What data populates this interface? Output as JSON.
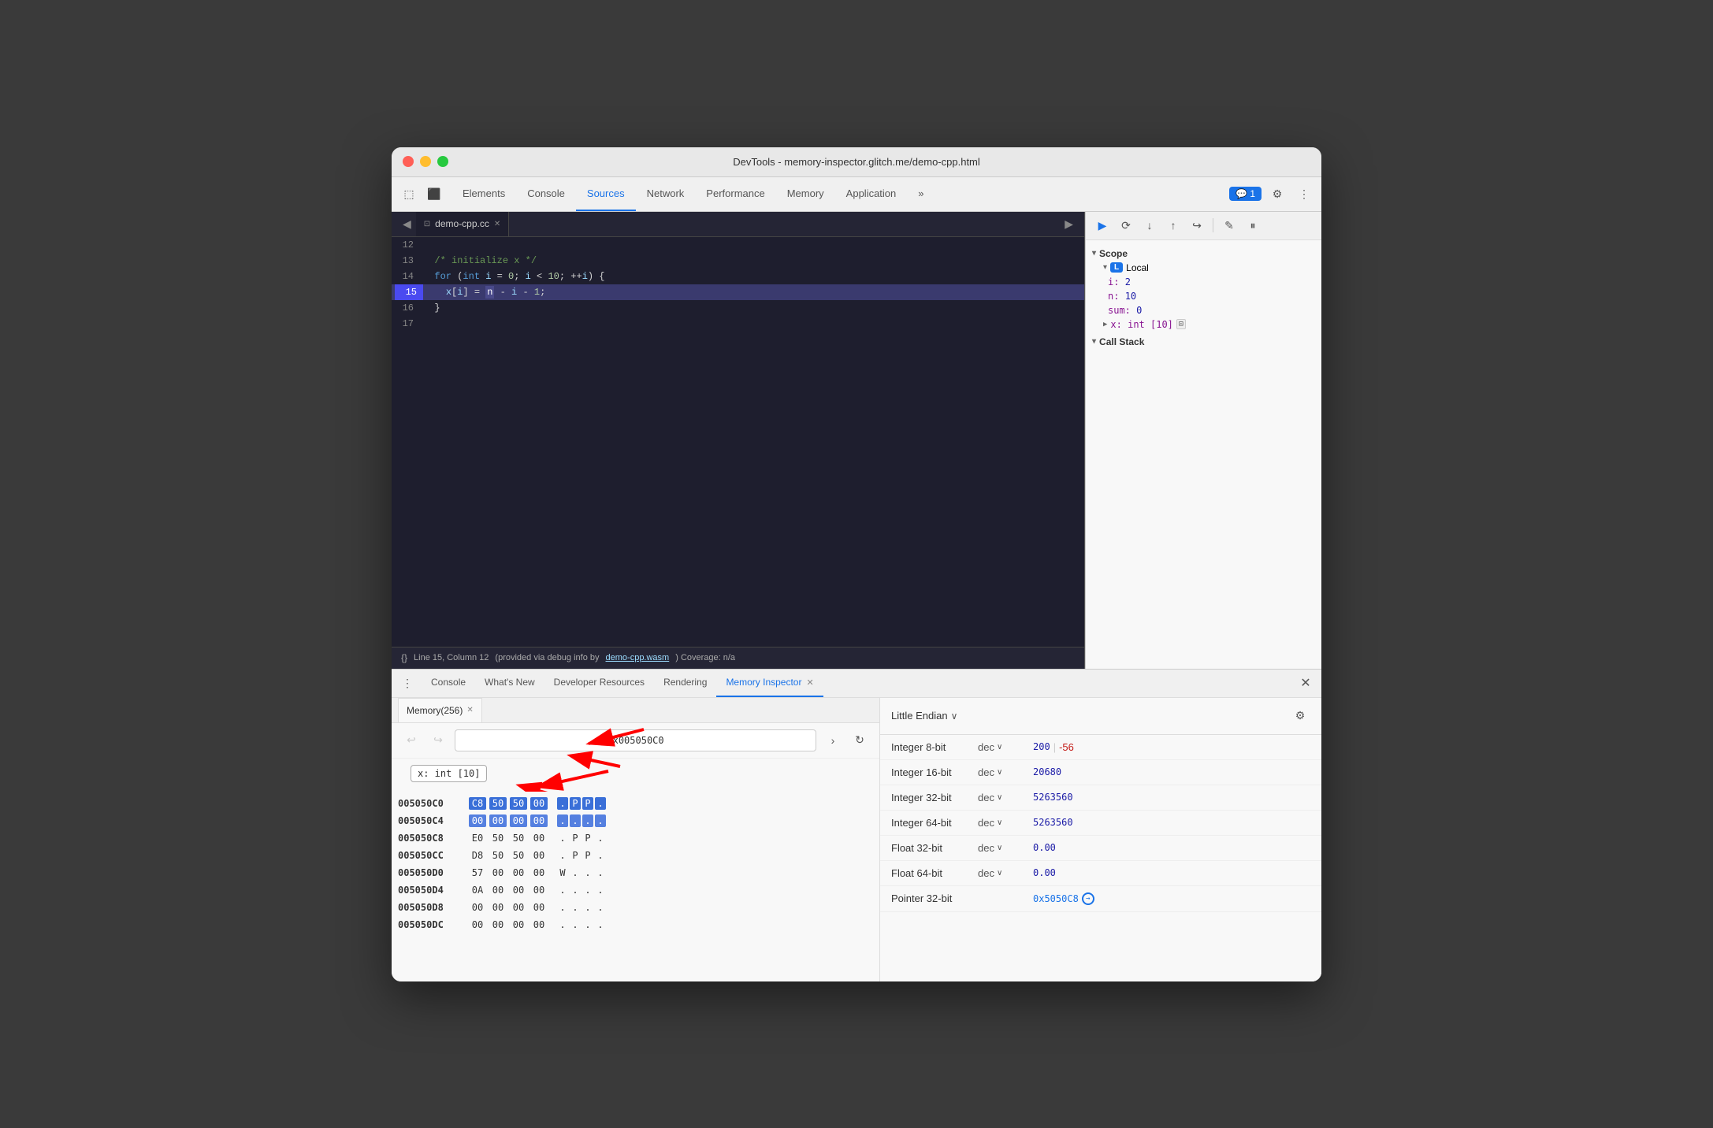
{
  "window": {
    "title": "DevTools - memory-inspector.glitch.me/demo-cpp.html"
  },
  "nav": {
    "tabs": [
      "Elements",
      "Console",
      "Sources",
      "Network",
      "Performance",
      "Memory",
      "Application"
    ],
    "active_tab": "Sources",
    "more_label": "»",
    "chat_badge": "💬 1",
    "settings_icon": "⚙",
    "more_vert_icon": "⋮"
  },
  "sources_panel": {
    "file_tab": "demo-cpp.cc",
    "lines": [
      {
        "num": "12",
        "content": "",
        "highlighted": false
      },
      {
        "num": "13",
        "content": "  /* initialize x */",
        "highlighted": false
      },
      {
        "num": "14",
        "content": "  for (int i = 0; i < 10; ++i) {",
        "highlighted": false
      },
      {
        "num": "15",
        "content": "    x[i] = n - i - 1;",
        "highlighted": true
      },
      {
        "num": "16",
        "content": "  }",
        "highlighted": false
      },
      {
        "num": "17",
        "content": "",
        "highlighted": false
      }
    ],
    "status": {
      "format_btn": "{}",
      "position": "Line 15, Column 12",
      "note": "(provided via debug info by",
      "link": "demo-cpp.wasm",
      "coverage": ") Coverage: n/a"
    }
  },
  "debugger": {
    "buttons": [
      "▶",
      "⟳",
      "↓",
      "↑",
      "↪",
      "✎",
      "⏸"
    ]
  },
  "scope": {
    "header": "Scope",
    "local_label": "Local",
    "items": [
      {
        "key": "i:",
        "val": "2"
      },
      {
        "key": "n:",
        "val": "10"
      },
      {
        "key": "sum:",
        "val": "0"
      },
      {
        "key": "▶ x: int [10]",
        "val": "",
        "has_memory": true
      }
    ],
    "call_stack": "▾ Call Stack"
  },
  "drawer": {
    "tabs": [
      "Console",
      "What's New",
      "Developer Resources",
      "Rendering",
      "Memory Inspector"
    ],
    "active_tab": "Memory Inspector"
  },
  "memory_inspector": {
    "tab_label": "Memory(256)",
    "address": "0x005050C0",
    "variable_tag": "x: int [10]",
    "rows": [
      {
        "addr": "005050C0",
        "bytes": [
          "C8",
          "50",
          "50",
          "00"
        ],
        "ascii": [
          ".",
          "P",
          "P",
          "."
        ],
        "byte_hl": [
          true,
          true,
          true,
          true
        ],
        "ascii_hl": [
          true,
          true,
          true,
          true
        ]
      },
      {
        "addr": "005050C4",
        "bytes": [
          "00",
          "00",
          "00",
          "00"
        ],
        "ascii": [
          ".",
          ".",
          ".",
          "."
        ],
        "byte_hl": [
          true,
          true,
          true,
          true
        ],
        "ascii_hl": [
          true,
          true,
          true,
          true
        ]
      },
      {
        "addr": "005050C8",
        "bytes": [
          "E0",
          "50",
          "50",
          "00"
        ],
        "ascii": [
          ".",
          "P",
          "P",
          "."
        ],
        "byte_hl": [
          false,
          false,
          false,
          false
        ],
        "ascii_hl": [
          false,
          false,
          false,
          false
        ]
      },
      {
        "addr": "005050CC",
        "bytes": [
          "D8",
          "50",
          "50",
          "00"
        ],
        "ascii": [
          ".",
          "P",
          "P",
          "."
        ],
        "byte_hl": [
          false,
          false,
          false,
          false
        ],
        "ascii_hl": [
          false,
          false,
          false,
          false
        ]
      },
      {
        "addr": "005050D0",
        "bytes": [
          "57",
          "00",
          "00",
          "00"
        ],
        "ascii": [
          "W",
          ".",
          ".",
          "."
        ],
        "byte_hl": [
          false,
          false,
          false,
          false
        ],
        "ascii_hl": [
          false,
          false,
          false,
          false
        ]
      },
      {
        "addr": "005050D4",
        "bytes": [
          "0A",
          "00",
          "00",
          "00"
        ],
        "ascii": [
          ".",
          ".",
          ".",
          "."
        ],
        "byte_hl": [
          false,
          false,
          false,
          false
        ],
        "ascii_hl": [
          false,
          false,
          false,
          false
        ]
      },
      {
        "addr": "005050D8",
        "bytes": [
          "00",
          "00",
          "00",
          "00"
        ],
        "ascii": [
          ".",
          ".",
          ".",
          "."
        ],
        "byte_hl": [
          false,
          false,
          false,
          false
        ],
        "ascii_hl": [
          false,
          false,
          false,
          false
        ]
      },
      {
        "addr": "005050DC",
        "bytes": [
          "00",
          "00",
          "00",
          "00"
        ],
        "ascii": [
          ".",
          ".",
          ".",
          "."
        ],
        "byte_hl": [
          false,
          false,
          false,
          false
        ],
        "ascii_hl": [
          false,
          false,
          false,
          false
        ]
      }
    ],
    "endian": "Little Endian",
    "inspector_rows": [
      {
        "type": "Integer 8-bit",
        "format": "dec",
        "value": "200",
        "value2": "-56"
      },
      {
        "type": "Integer 16-bit",
        "format": "dec",
        "value": "20680"
      },
      {
        "type": "Integer 32-bit",
        "format": "dec",
        "value": "5263560"
      },
      {
        "type": "Integer 64-bit",
        "format": "dec",
        "value": "5263560"
      },
      {
        "type": "Float 32-bit",
        "format": "dec",
        "value": "0.00"
      },
      {
        "type": "Float 64-bit",
        "format": "dec",
        "value": "0.00"
      },
      {
        "type": "Pointer 32-bit",
        "format": "",
        "value": "0x5050C8",
        "is_pointer": true
      }
    ]
  }
}
